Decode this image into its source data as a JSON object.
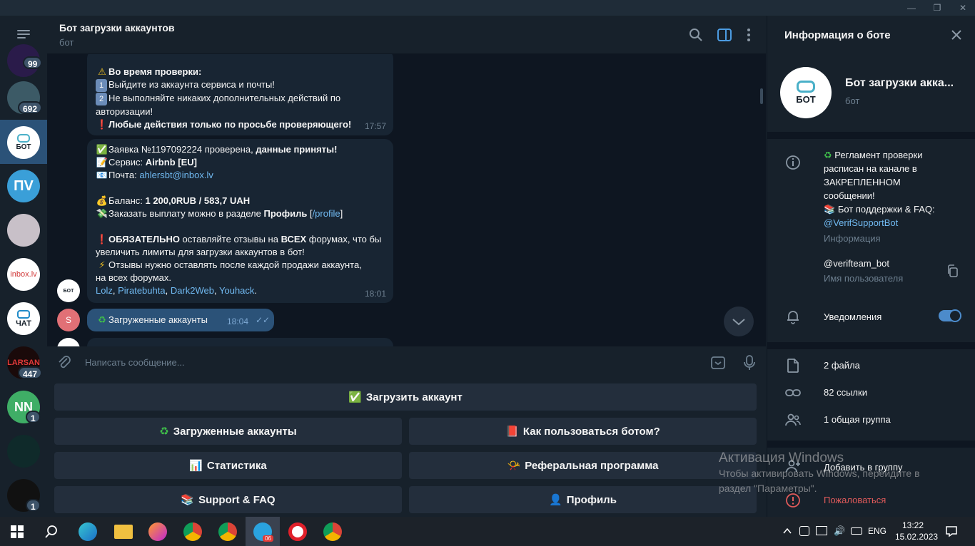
{
  "window": {
    "minimize": "—",
    "maximize": "❐",
    "close": "✕"
  },
  "chat_list": {
    "items": [
      {
        "initials": "",
        "badge": "99",
        "color": "#2a1b4a"
      },
      {
        "initials": "",
        "badge": "692",
        "color": "#3c5a66"
      },
      {
        "initials": "БОТ",
        "badge": "",
        "color": "#ffffff"
      },
      {
        "initials": "ПV",
        "badge": "",
        "color": "#3a9fd8"
      },
      {
        "initials": "",
        "badge": "",
        "color": "#c8c0c8"
      },
      {
        "initials": "inbox.lv",
        "badge": "",
        "color": "#ffffff"
      },
      {
        "initials": "ЧАТ",
        "badge": "",
        "color": "#ffffff"
      },
      {
        "initials": "LARSAN",
        "badge": "447",
        "color": "#1a0a0a"
      },
      {
        "initials": "NN",
        "badge": "1",
        "color": "#3fae66"
      },
      {
        "initials": "",
        "badge": "",
        "color": "#0f2a2a"
      },
      {
        "initials": "",
        "badge": "1",
        "color": "#111111"
      }
    ]
  },
  "header": {
    "title": "Бот загрузки аккаунтов",
    "subtitle": "бот"
  },
  "messages": {
    "msg1": {
      "warn_title": "Во время проверки:",
      "line1": "Выйдите из аккаунта сервиса и почты!",
      "line2": "Не выполняйте никаких дополнительных действий по",
      "line2b": "авторизации!",
      "line3": "Любые действия только по просьбе проверяющего!",
      "time": "17:57"
    },
    "msg2": {
      "l1a": "Заявка №1197092224 проверена, ",
      "l1b": "данные приняты!",
      "l2a": "Сервис: ",
      "l2b": "Airbnb [EU]",
      "l3a": "Почта: ",
      "l3b": "ahlersbt@inbox.lv",
      "l4a": "Баланс: ",
      "l4b": "1 200,0RUB  / 583,7 UAH",
      "l5a": "Заказать выплату можно в разделе ",
      "l5b": "Профиль",
      "l5c": " [",
      "l5d": "/profile",
      "l5e": "]",
      "l6a": "ОБЯЗАТЕЛЬНО",
      "l6b": " оставляйте отзывы на ",
      "l6c": "ВСЕХ",
      "l6d": " форумах, что бы",
      "l7": "увеличить лимиты для загрузки аккаунтов в бот!",
      "l8": "Отзывы нужно оставлять после каждой продажи аккаунта,",
      "l9": "на всех форумах.",
      "links": [
        "Lolz",
        "Piratebuhta",
        "Dark2Web",
        "Youhack"
      ],
      "time": "18:01"
    },
    "msg3": {
      "text": "Загруженные аккаунты",
      "time": "18:04",
      "sender_initial": "S"
    }
  },
  "composer": {
    "placeholder": "Написать сообщение..."
  },
  "keyboard": {
    "upload": "Загрузить аккаунт",
    "uploaded": "Загруженные аккаунты",
    "howto": "Как пользоваться ботом?",
    "stats": "Статистика",
    "referral": "Реферальная программа",
    "support": "Support & FAQ",
    "profile": "Профиль"
  },
  "right_panel": {
    "title": "Информация о боте",
    "bot_name": "Бот загрузки акка...",
    "bot_sub": "бот",
    "avatar_text": "БОТ",
    "info_lines": [
      "Регламент проверки",
      "расписан на канале в",
      "ЗАКРЕПЛЕННОМ",
      "сообщении!"
    ],
    "info_support": "Бот поддержки & FAQ:",
    "info_support_link": "@VerifSupportBot",
    "info_label": "Информация",
    "username": "@verifteam_bot",
    "username_label": "Имя пользователя",
    "notifications": "Уведомления",
    "files": "2 файла",
    "links": "82 ссылки",
    "groups": "1 общая группа",
    "add_group": "Добавить в группу",
    "report": "Пожаловаться"
  },
  "activation": {
    "title": "Активация Windows",
    "text": "Чтобы активировать Windows, перейдите в раздел \"Параметры\"."
  },
  "taskbar": {
    "lang": "ENG",
    "time": "13:22",
    "date": "15.02.2023",
    "telegram_badge": "06"
  }
}
